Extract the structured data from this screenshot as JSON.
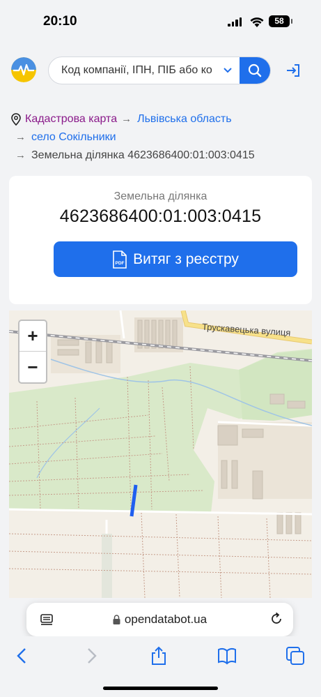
{
  "status_bar": {
    "time": "20:10",
    "battery": "58"
  },
  "search": {
    "placeholder": "Код компанії, ІПН, ПІБ або ко"
  },
  "breadcrumbs": [
    {
      "label": "Кадастрова карта"
    },
    {
      "label": "Львівська область"
    },
    {
      "label": "село Сокільники"
    },
    {
      "label": "Земельна ділянка 4623686400:01:003:0415"
    }
  ],
  "parcel": {
    "subtitle": "Земельна ділянка",
    "number": "4623686400:01:003:0415",
    "extract_button": "Витяг з реєстру",
    "pdf_badge": "PDF"
  },
  "map": {
    "zoom_in": "+",
    "zoom_out": "−",
    "street_label": "Трускавецька вулиця",
    "colors": {
      "green": "#d9e9c9",
      "land": "#f3efe7",
      "road_yellow": "#f7e18a",
      "parcel": "#1f5ff0"
    }
  },
  "browser": {
    "url": "opendatabot.ua"
  },
  "colors": {
    "accent": "#1f6feb",
    "breadcrumb_root": "#8a1a8a"
  }
}
